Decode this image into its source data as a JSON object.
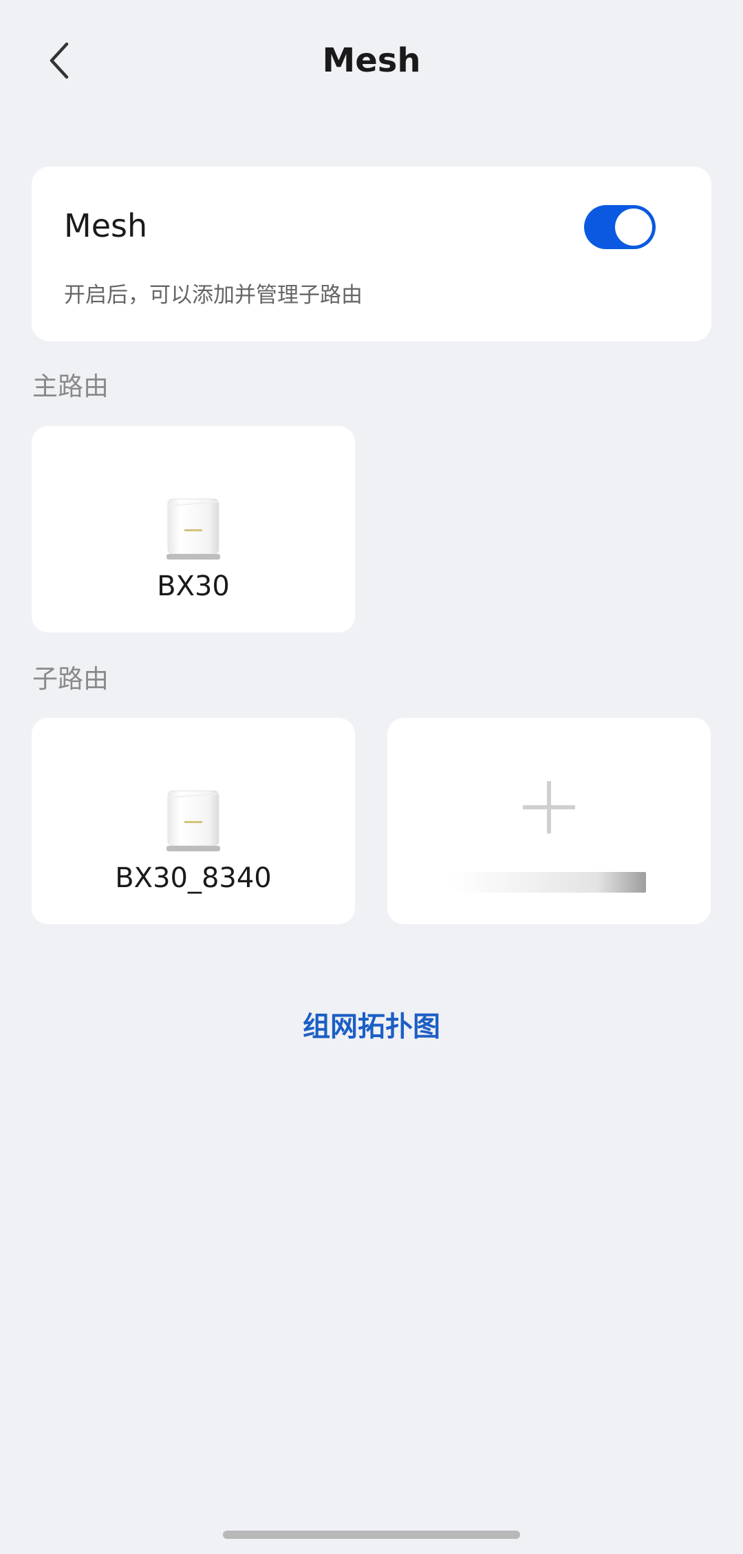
{
  "header": {
    "title": "Mesh",
    "back_icon": "chevron-left-icon"
  },
  "mesh_card": {
    "label": "Mesh",
    "description": "开启后，可以添加并管理子路由",
    "toggle_on": true,
    "toggle_color": "#0a59e0"
  },
  "main_router": {
    "section_label": "主路由",
    "name": "BX30"
  },
  "sub_routers": {
    "section_label": "子路由",
    "items": [
      {
        "name": "BX30_8340"
      }
    ],
    "add_icon": "plus-icon"
  },
  "topology_link": "组网拓扑图",
  "colors": {
    "background": "#f0f1f5",
    "accent": "#0a59e0",
    "link": "#1c5fc4"
  }
}
